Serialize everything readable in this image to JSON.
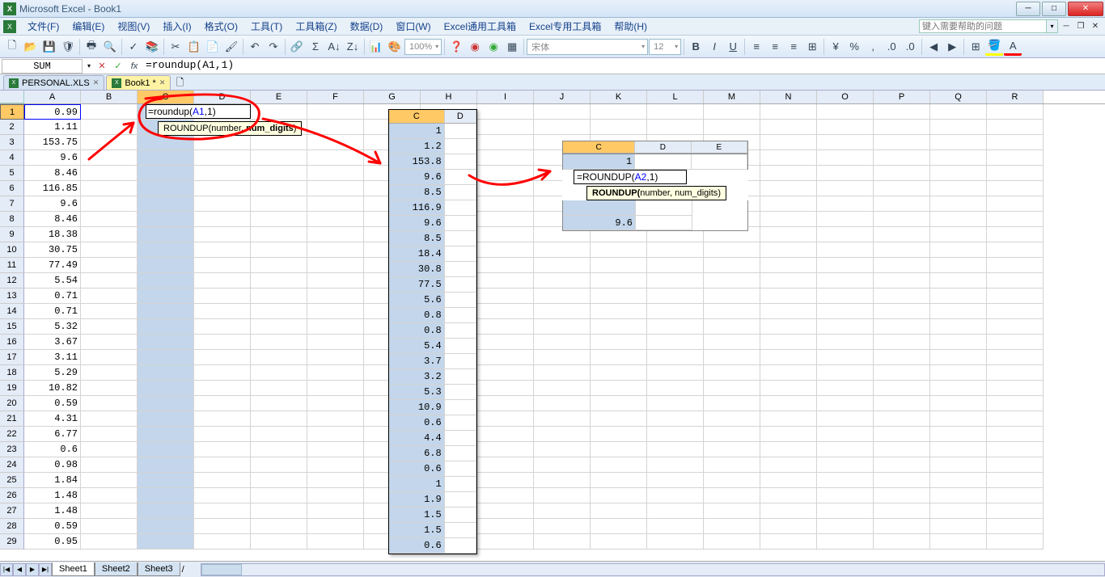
{
  "title": "Microsoft Excel - Book1",
  "menu": [
    "文件(F)",
    "编辑(E)",
    "视图(V)",
    "插入(I)",
    "格式(O)",
    "工具(T)",
    "工具箱(Z)",
    "数据(D)",
    "窗口(W)",
    "Excel通用工具箱",
    "Excel专用工具箱",
    "帮助(H)"
  ],
  "help_placeholder": "键入需要帮助的问题",
  "toolbar": {
    "zoom": "100%",
    "font_name": "宋体",
    "font_size": "12"
  },
  "formula_bar": {
    "name_box": "SUM",
    "formula": "=roundup(A1,1)"
  },
  "wb_tabs": {
    "t1": "PERSONAL.XLS",
    "t2": "Book1 *"
  },
  "col_headers": [
    "A",
    "B",
    "C",
    "D",
    "E",
    "F",
    "G",
    "H",
    "I",
    "J",
    "K",
    "L",
    "M",
    "N",
    "O",
    "P",
    "Q",
    "R"
  ],
  "rows": [
    {
      "n": 1,
      "a": "0.99"
    },
    {
      "n": 2,
      "a": "1.11"
    },
    {
      "n": 3,
      "a": "153.75"
    },
    {
      "n": 4,
      "a": "9.6"
    },
    {
      "n": 5,
      "a": "8.46"
    },
    {
      "n": 6,
      "a": "116.85"
    },
    {
      "n": 7,
      "a": "9.6"
    },
    {
      "n": 8,
      "a": "8.46"
    },
    {
      "n": 9,
      "a": "18.38"
    },
    {
      "n": 10,
      "a": "30.75"
    },
    {
      "n": 11,
      "a": "77.49"
    },
    {
      "n": 12,
      "a": "5.54"
    },
    {
      "n": 13,
      "a": "0.71"
    },
    {
      "n": 14,
      "a": "0.71"
    },
    {
      "n": 15,
      "a": "5.32"
    },
    {
      "n": 16,
      "a": "3.67"
    },
    {
      "n": 17,
      "a": "3.11"
    },
    {
      "n": 18,
      "a": "5.29"
    },
    {
      "n": 19,
      "a": "10.82"
    },
    {
      "n": 20,
      "a": "0.59"
    },
    {
      "n": 21,
      "a": "4.31"
    },
    {
      "n": 22,
      "a": "6.77"
    },
    {
      "n": 23,
      "a": "0.6"
    },
    {
      "n": 24,
      "a": "0.98"
    },
    {
      "n": 25,
      "a": "1.84"
    },
    {
      "n": 26,
      "a": "1.48"
    },
    {
      "n": 27,
      "a": "1.48"
    },
    {
      "n": 28,
      "a": "0.59"
    },
    {
      "n": 29,
      "a": "0.95"
    }
  ],
  "editing_formula": "=roundup(A1,1)",
  "tooltip1_fn": "ROUNDUP(",
  "tooltip1_arg1": "number",
  "tooltip1_sep": ", ",
  "tooltip1_arg2": "num_digits",
  "tooltip1_close": ")",
  "overlay1": {
    "headers": [
      "C",
      "D"
    ],
    "values": [
      "1",
      "1.2",
      "153.8",
      "9.6",
      "8.5",
      "116.9",
      "9.6",
      "8.5",
      "18.4",
      "30.8",
      "77.5",
      "5.6",
      "0.8",
      "0.8",
      "5.4",
      "3.7",
      "3.2",
      "5.3",
      "10.9",
      "0.6",
      "4.4",
      "6.8",
      "0.6",
      "1",
      "1.9",
      "1.5",
      "1.5",
      "0.6"
    ]
  },
  "overlay2": {
    "headers": [
      "C",
      "D",
      "E"
    ],
    "row1_c": "1",
    "formula": "=ROUNDUP(A2,1)",
    "row3_c": "",
    "row4_c": "9.6",
    "tooltip_fn": "ROUNDUP(",
    "tooltip_arg1": "number",
    "tooltip_sep": ", ",
    "tooltip_arg2": "num_digits",
    "tooltip_close": ")"
  },
  "sheet_tabs": [
    "Sheet1",
    "Sheet2",
    "Sheet3"
  ]
}
